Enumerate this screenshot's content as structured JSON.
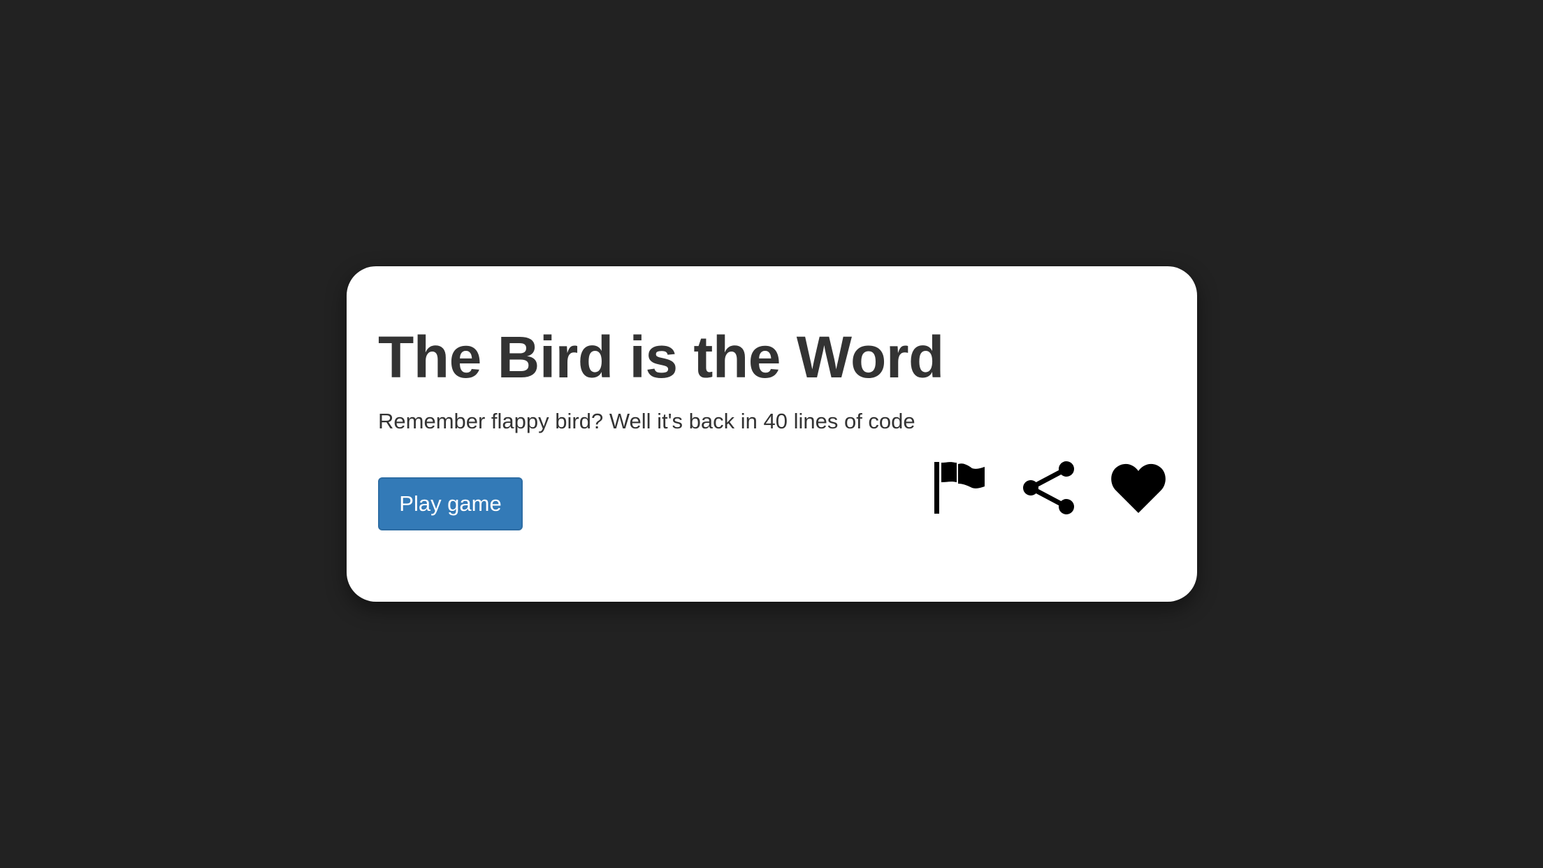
{
  "card": {
    "title": "The Bird is the Word",
    "description": "Remember flappy bird? Well it's back in 40 lines of code",
    "play_label": "Play game"
  },
  "actions": {
    "icons": [
      "flag-icon",
      "share-icon",
      "heart-icon"
    ]
  },
  "colors": {
    "background": "#222222",
    "card": "#ffffff",
    "text": "#333333",
    "primary_button": "#337ab7",
    "icons": "#000000"
  }
}
